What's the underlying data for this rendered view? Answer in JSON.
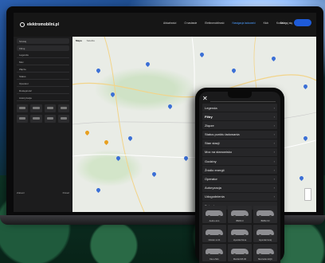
{
  "site": {
    "logo": "elektromobilni.pl",
    "nav": [
      "Aktualności",
      "O nastawie",
      "Elektromobilność",
      "Nawigacja ładowarki",
      "Klub",
      "Kontakt"
    ],
    "nav_active_index": 3,
    "login": "Zaloguj się"
  },
  "map": {
    "tabs": [
      "Mapa",
      "Satelita"
    ]
  },
  "sidebar": {
    "rows": [
      "Szukaj",
      "Filtruj",
      "Legenda",
      "Moc",
      "Złącze",
      "Status",
      "Operator",
      "Dostępność",
      "Autoryzacja"
    ],
    "footer_left": "Zobacz",
    "footer_right": "Pokaż"
  },
  "phone": {
    "filter_items": [
      {
        "label": "Legenda",
        "strong": false
      },
      {
        "label": "Filtry",
        "strong": true
      },
      {
        "label": "Złącze",
        "strong": false
      },
      {
        "label": "Status punktu ładowania",
        "strong": false
      },
      {
        "label": "Stan stacji",
        "strong": false
      },
      {
        "label": "Moc na stanowisko",
        "strong": false
      },
      {
        "label": "Godziny",
        "strong": false
      },
      {
        "label": "Źródło energii",
        "strong": false
      },
      {
        "label": "Operator",
        "strong": false
      },
      {
        "label": "Autoryzacja",
        "strong": false
      },
      {
        "label": "Udogodnienia",
        "strong": false
      },
      {
        "label": "Pojazd",
        "strong": false
      }
    ],
    "cars": [
      "Audi e-tron",
      "BMW i3",
      "BMW iX3",
      "Citroën ë-C4",
      "Hyundai Kona",
      "Hyundai Ioniq",
      "Kia e-Niro",
      "Mazda MX-30",
      "Mercedes EQC"
    ]
  },
  "colors": {
    "accent": "#1e5bd8",
    "pin_blue": "#3b6fd6",
    "pin_orange": "#e8a020"
  }
}
